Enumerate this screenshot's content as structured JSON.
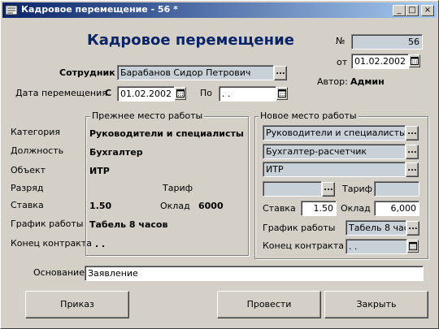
{
  "window": {
    "title": "Кадровое перемещение - 56 *",
    "controls": [
      "_",
      "□",
      "×"
    ]
  },
  "form": {
    "heading": "Кадровое перемещение",
    "number_label": "№",
    "number_value": "56",
    "from_label": "от",
    "from_date": "01.02.2002",
    "author_label": "Автор:",
    "author_value": "Админ",
    "employee_label": "Сотрудник",
    "employee_value": "Барабанов Сидор Петрович",
    "transfer_date_label": "Дата перемещения",
    "c_label": "С",
    "c_date": "01.02.2002",
    "po_label": "По",
    "po_date": " . .",
    "browse": "...",
    "basis_label": "Основание",
    "basis_value": "Заявление"
  },
  "row_labels": {
    "category": "Категория",
    "position": "Должность",
    "object": "Объект",
    "grade": "Разряд",
    "rate": "Ставка",
    "schedule": "График работы",
    "contract_end": "Конец контракта"
  },
  "previous": {
    "title": "Прежнее место работы",
    "category": "Руководители и специалисты",
    "position": "Бухгалтер",
    "object": "ИТР",
    "tariff_label": "Тариф",
    "rate": "1.50",
    "salary_label": "Оклад",
    "salary": "6000",
    "schedule": "Табель 8 часов",
    "contract_end": ". ."
  },
  "new": {
    "title": "Новое место работы",
    "category": "Руководители и специалисты",
    "position": "Бухгалтер-расчетчик",
    "object": "ИТР",
    "grade": "",
    "tariff_label": "Тариф",
    "tariff": "",
    "rate_label": "Ставка",
    "rate": "1.50",
    "salary_label": "Оклад",
    "salary": "6,000",
    "schedule_label": "График работы",
    "schedule": "Табель 8 час",
    "contract_end_label": "Конец контракта",
    "contract_end": " . ."
  },
  "buttons": {
    "order": "Приказ",
    "post": "Провести",
    "close": "Закрыть"
  }
}
